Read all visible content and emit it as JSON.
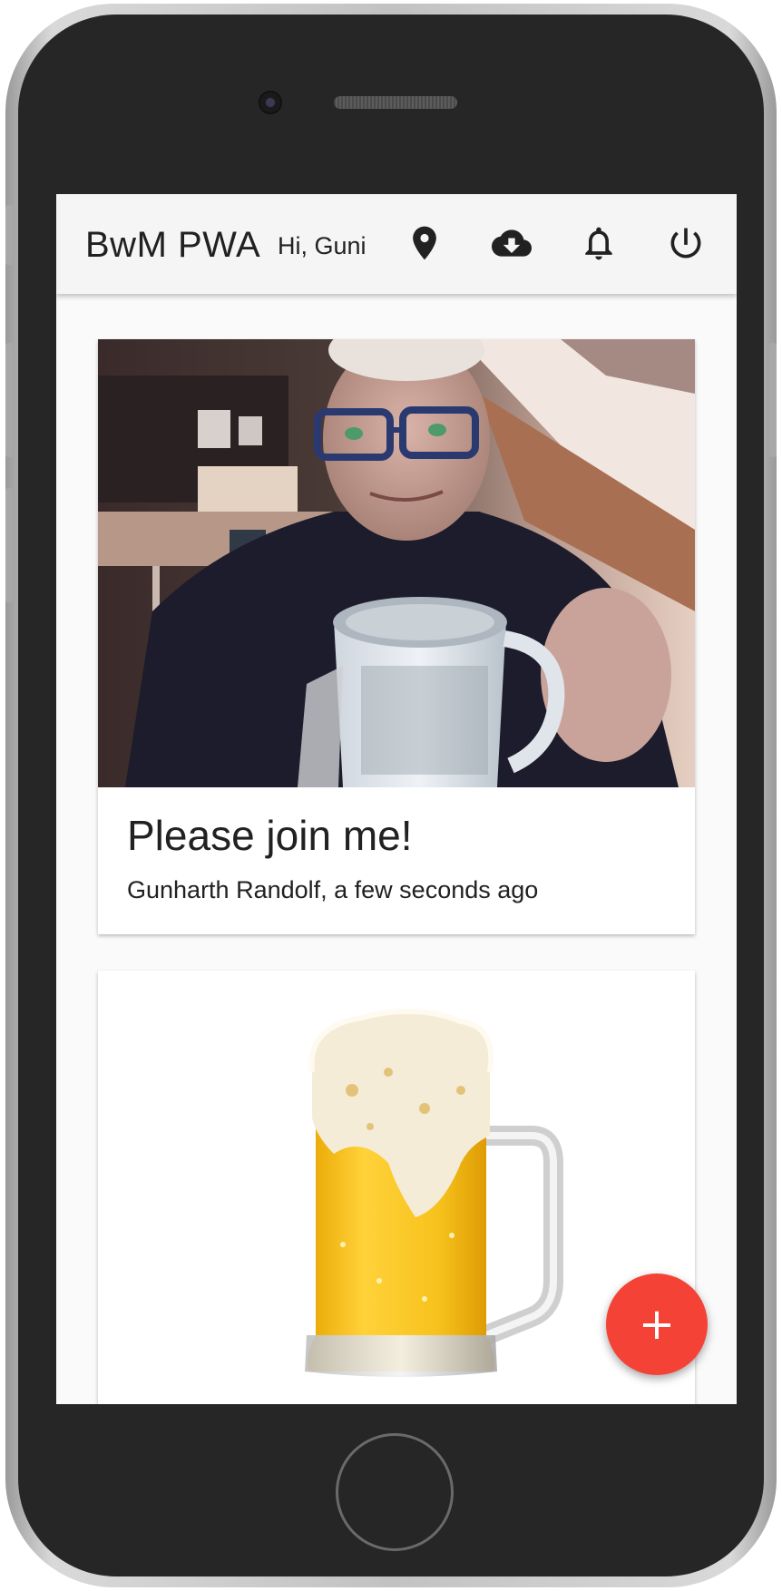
{
  "appbar": {
    "title": "BwM PWA",
    "greeting": "Hi, Guni",
    "icons": [
      "location-pin-icon",
      "cloud-download-icon",
      "bell-icon",
      "power-icon"
    ]
  },
  "posts": [
    {
      "image": "photo of man holding mug",
      "title": "Please join me!",
      "subtitle": "Gunharth Randolf, a few seconds ago"
    },
    {
      "image": "beer mug"
    }
  ],
  "fab": {
    "label": "+",
    "color": "#f44336"
  },
  "colors": {
    "appbar": "#f5f5f5",
    "background": "#fafafa",
    "fab": "#f44336"
  }
}
